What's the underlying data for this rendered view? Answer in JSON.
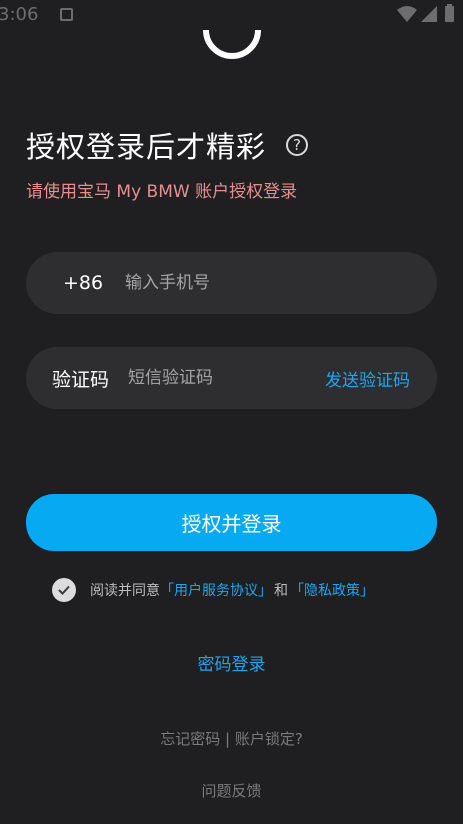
{
  "status_bar": {
    "time": "3:06",
    "icons": [
      "notification-icon",
      "wifi-icon",
      "signal-icon",
      "battery-icon"
    ]
  },
  "header": {
    "title": "授权登录后才精彩",
    "help_icon": "?",
    "subtitle": "请使用宝马 My BMW 账户授权登录"
  },
  "phone_field": {
    "country_code": "+86",
    "placeholder": "输入手机号",
    "value": ""
  },
  "code_field": {
    "label": "验证码",
    "placeholder": "短信验证码",
    "value": "",
    "send_label": "发送验证码"
  },
  "login_button": {
    "label": "授权并登录"
  },
  "agreement": {
    "checked": true,
    "prefix": "阅读并同意",
    "terms_link": "「用户服务协议」",
    "and": "和",
    "privacy_link": "「隐私政策」"
  },
  "password_login": {
    "label": "密码登录"
  },
  "help_links": {
    "forgot_password": "忘记密码",
    "separator": " | ",
    "account_locked": "账户锁定?",
    "feedback": "问题反馈"
  },
  "colors": {
    "background": "#1f1f21",
    "field_background": "#2e2e30",
    "accent": "#07a9f3",
    "link": "#1da6f2",
    "subtitle": "#e78e8f"
  }
}
